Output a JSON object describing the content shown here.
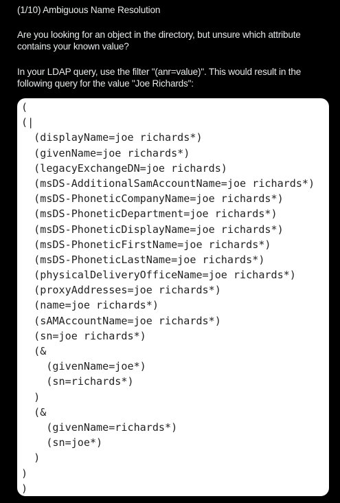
{
  "post": {
    "title": "(1/10) Ambiguous Name Resolution",
    "paragraph1": "Are you looking for an object in the directory, but unsure which attribute contains your known value?",
    "paragraph2": "In your LDAP query, use the filter \"(anr=value)\". This would result in the following query for the value \"Joe Richards\":"
  },
  "code_image": {
    "lines": [
      "(",
      "(|",
      "  (displayName=joe richards*)",
      "  (givenName=joe richards*)",
      "  (legacyExchangeDN=joe richards)",
      "  (msDS-AdditionalSamAccountName=joe richards*)",
      "  (msDS-PhoneticCompanyName=joe richards*)",
      "  (msDS-PhoneticDepartment=joe richards*)",
      "  (msDS-PhoneticDisplayName=joe richards*)",
      "  (msDS-PhoneticFirstName=joe richards*)",
      "  (msDS-PhoneticLastName=joe richards*)",
      "  (physicalDeliveryOfficeName=joe richards*)",
      "  (proxyAddresses=joe richards*)",
      "  (name=joe richards*)",
      "  (sAMAccountName=joe richards*)",
      "  (sn=joe richards*)",
      "  (&",
      "    (givenName=joe*)",
      "    (sn=richards*)",
      "  )",
      "  (&",
      "    (givenName=richards*)",
      "    (sn=joe*)",
      "  )",
      ")",
      ")"
    ]
  }
}
